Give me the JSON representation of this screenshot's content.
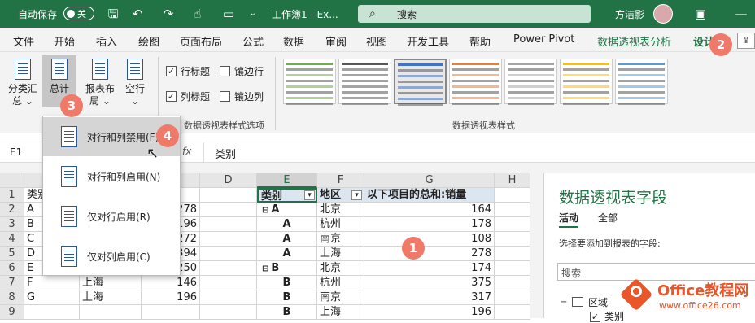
{
  "titlebar": {
    "autosave": "自动保存",
    "toggle": "关",
    "doc_title": "工作簿1 - Ex...",
    "search_placeholder": "搜索",
    "user": "方洁影"
  },
  "menu": [
    "文件",
    "开始",
    "插入",
    "绘图",
    "页面布局",
    "公式",
    "数据",
    "审阅",
    "视图",
    "开发工具",
    "帮助",
    "Power Pivot",
    "数据透视表分析",
    "设计"
  ],
  "ribbon": {
    "subtotal": [
      "分类汇",
      "总"
    ],
    "grandtotal": [
      "总计"
    ],
    "report_layout": [
      "报表布",
      "局"
    ],
    "blank_rows": [
      "空行"
    ],
    "options": [
      {
        "label": "行标题",
        "checked": true
      },
      {
        "label": "镶边行",
        "checked": false
      },
      {
        "label": "列标题",
        "checked": true
      },
      {
        "label": "镶边列",
        "checked": false
      }
    ],
    "options_group_label": "数据透视表样式选项",
    "styles_group_label": "数据透视表样式",
    "style_colors": [
      "#70ad47",
      "#595959",
      "#4472c4",
      "#ed7d31",
      "#a5a5a5",
      "#ffc000",
      "#5b9bd5"
    ]
  },
  "dropdown": {
    "items": [
      "对行和列禁用(F)",
      "对行和列启用(N)",
      "仅对行启用(R)",
      "仅对列启用(C)"
    ]
  },
  "formulabar": {
    "namebox": "E1",
    "fx": "fx",
    "content": "类别"
  },
  "columns": [
    "D",
    "E",
    "F",
    "G",
    "H"
  ],
  "rows": [
    "1",
    "2",
    "3",
    "4",
    "5",
    "6",
    "7",
    "8",
    "9"
  ],
  "source": [
    [
      "类别",
      "",
      ""
    ],
    [
      "A",
      "",
      "278"
    ],
    [
      "B",
      "",
      "196"
    ],
    [
      "C",
      "",
      "272"
    ],
    [
      "D",
      "",
      "394"
    ],
    [
      "E",
      "上海",
      "250"
    ],
    [
      "F",
      "上海",
      "146"
    ],
    [
      "G",
      "上海",
      "196"
    ],
    [
      "",
      "",
      "",
      ""
    ]
  ],
  "pivot": {
    "headers": [
      "类别",
      "地区",
      "以下项目的总和:销量"
    ],
    "rows": [
      [
        "A",
        "北京",
        "164",
        true
      ],
      [
        "A",
        "杭州",
        "178",
        false
      ],
      [
        "A",
        "南京",
        "108",
        false
      ],
      [
        "A",
        "上海",
        "278",
        false
      ],
      [
        "B",
        "北京",
        "174",
        true
      ],
      [
        "B",
        "杭州",
        "375",
        false
      ],
      [
        "B",
        "南京",
        "317",
        false
      ],
      [
        "B",
        "上海",
        "196",
        false
      ]
    ]
  },
  "panel": {
    "title": "数据透视表字段",
    "tabs": [
      "活动",
      "全部"
    ],
    "hint": "选择要添加到报表的字段:",
    "search": "搜索",
    "area": "区域",
    "field": "类别"
  },
  "badges": [
    "1",
    "2",
    "3",
    "4"
  ],
  "watermark": {
    "brand": "Office教程网",
    "url": "www.office26.com"
  }
}
